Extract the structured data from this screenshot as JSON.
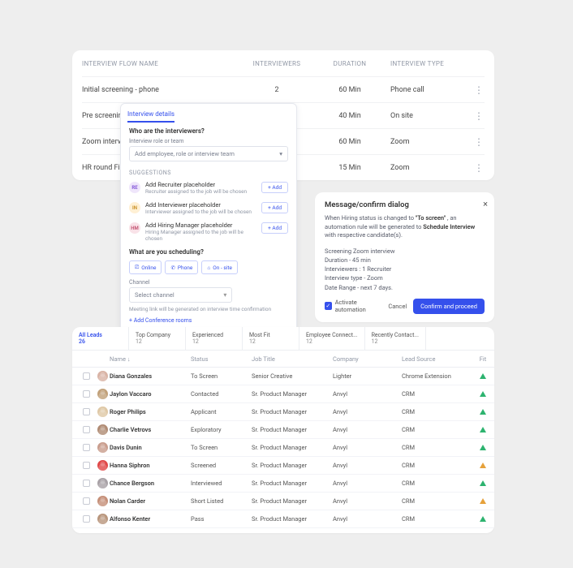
{
  "flow": {
    "headers": [
      "INTERVIEW FLOW NAME",
      "INTERVIEWERS",
      "DURATION",
      "INTERVIEW TYPE"
    ],
    "rows": [
      {
        "name": "Initial screening - phone",
        "interviewers": "2",
        "duration": "60 Min",
        "type": "Phone call"
      },
      {
        "name": "Pre screening",
        "interviewers": "",
        "duration": "40 Min",
        "type": "On site"
      },
      {
        "name": "Zoom interview",
        "interviewers": "",
        "duration": "60 Min",
        "type": "Zoom"
      },
      {
        "name": "HR round Final",
        "interviewers": "",
        "duration": "15 Min",
        "type": "Zoom"
      }
    ]
  },
  "details": {
    "tab": "Interview details",
    "q1": "Who are the interviewers?",
    "field_label": "Interview role or team",
    "placeholder": "Add employee, role or interview team",
    "suggestions_label": "SUGGESTIONS",
    "add_label": "+ Add",
    "suggestions": [
      {
        "badge": "RE",
        "badge_bg": "#efe6fb",
        "badge_fg": "#7b4ad6",
        "title": "Add Recruiter placeholder",
        "desc": "Recruiter assigned to the job will be chosen"
      },
      {
        "badge": "IN",
        "badge_bg": "#fff0d4",
        "badge_fg": "#c68a1a",
        "title": "Add Interviewer placeholder",
        "desc": "Interviewer assigned to the job will be chosen"
      },
      {
        "badge": "HM",
        "badge_bg": "#f9e2e8",
        "badge_fg": "#c04a6a",
        "title": "Add Hiring Manager placeholder",
        "desc": "Hiring Manager assigned to the job will be chosen"
      }
    ],
    "q2": "What are you scheduling?",
    "options": [
      "Online",
      "Phone",
      "On - site"
    ],
    "opt_icons": [
      "⎚",
      "✆",
      "⌂"
    ],
    "channel_label": "Channel",
    "channel_placeholder": "Select channel",
    "note": "Meeting link will be generated on interview time confirmation",
    "conf_link": "+  Add Conference rooms"
  },
  "dialog": {
    "title": "Message/confirm dialog",
    "text_pre": "When Hiring status is changed to ",
    "text_bold1": "\"To screen\"",
    "text_mid": " , an automation rule will be generated to ",
    "text_bold2": "Schedule Interview",
    "text_post": " with respective candidate(s).",
    "meta": [
      "Screening Zoom interview",
      "Duration - 45 min",
      "Interviewers : 1 Recruiter",
      "Interview type - Zoom",
      "Date Range - next 7 days."
    ],
    "chk": "Activate automation",
    "cancel": "Cancel",
    "confirm": "Confirm and proceed"
  },
  "leads": {
    "chips": [
      {
        "t": "All Leads",
        "c": "26",
        "active": true
      },
      {
        "t": "Top Company",
        "c": "12"
      },
      {
        "t": "Experienced",
        "c": "12"
      },
      {
        "t": "Most Fit",
        "c": "12"
      },
      {
        "t": "Employee Connect...",
        "c": "12"
      },
      {
        "t": "Recently Contact...",
        "c": "12"
      }
    ],
    "head": [
      "Name ↓",
      "Status",
      "Job Title",
      "Company",
      "Lead Source",
      "Fit"
    ],
    "rows": [
      {
        "av": "c1",
        "name": "Diana Gonzales",
        "status": "To Screen",
        "job": "Senior Creative",
        "company": "Lighter",
        "source": "Chrome Extension",
        "fit": "green"
      },
      {
        "av": "c2",
        "name": "Jaylon Vaccaro",
        "status": "Contacted",
        "job": "Sr. Product Manager",
        "company": "Anvyl",
        "source": "CRM",
        "fit": "green"
      },
      {
        "av": "c3",
        "name": "Roger Philips",
        "status": "Applicant",
        "job": "Sr. Product Manager",
        "company": "Anvyl",
        "source": "CRM",
        "fit": "green"
      },
      {
        "av": "c4",
        "name": "Charlie Vetrovs",
        "status": "Exploratory",
        "job": "Sr. Product Manager",
        "company": "Anvyl",
        "source": "CRM",
        "fit": "green"
      },
      {
        "av": "c5",
        "name": "Davis Dunin",
        "status": "To Screen",
        "job": "Sr. Product Manager",
        "company": "Anvyl",
        "source": "CRM",
        "fit": "green"
      },
      {
        "av": "c6",
        "name": "Hanna Siphron",
        "status": "Screened",
        "job": "Sr. Product Manager",
        "company": "Anvyl",
        "source": "CRM",
        "fit": "amber"
      },
      {
        "av": "c7",
        "name": "Chance Bergson",
        "status": "Interviewed",
        "job": "Sr. Product Manager",
        "company": "Anvyl",
        "source": "CRM",
        "fit": "green"
      },
      {
        "av": "c8",
        "name": "Nolan Carder",
        "status": "Short Listed",
        "job": "Sr. Product Manager",
        "company": "Anvyl",
        "source": "CRM",
        "fit": "amber"
      },
      {
        "av": "c9",
        "name": "Alfonso Kenter",
        "status": "Pass",
        "job": "Sr. Product Manager",
        "company": "Anvyl",
        "source": "CRM",
        "fit": "green"
      }
    ]
  }
}
